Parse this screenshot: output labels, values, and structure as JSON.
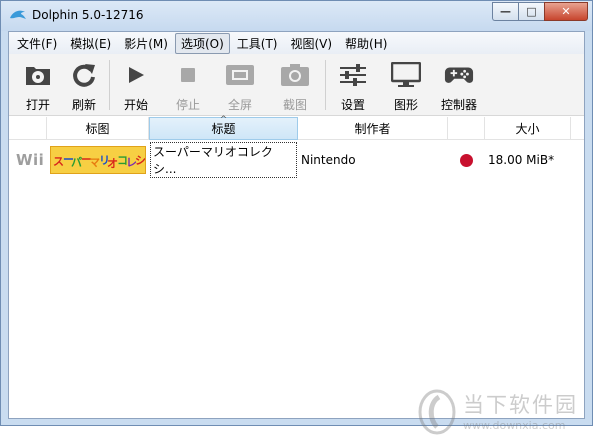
{
  "window": {
    "title": "Dolphin 5.0-12716",
    "controls": {
      "minimize": "—",
      "maximize": "□",
      "close": "✕"
    }
  },
  "menubar": {
    "items": [
      {
        "label": "文件(F)",
        "active": false
      },
      {
        "label": "模拟(E)",
        "active": false
      },
      {
        "label": "影片(M)",
        "active": false
      },
      {
        "label": "选项(O)",
        "active": true
      },
      {
        "label": "工具(T)",
        "active": false
      },
      {
        "label": "视图(V)",
        "active": false
      },
      {
        "label": "帮助(H)",
        "active": false
      }
    ]
  },
  "toolbar": {
    "open": "打开",
    "refresh": "刷新",
    "play": "开始",
    "stop": "停止",
    "fullscreen": "全屏",
    "screenshot": "截图",
    "config": "设置",
    "graphics": "图形",
    "controllers": "控制器"
  },
  "table": {
    "columns": {
      "banner": "标图",
      "title": "标题",
      "maker": "制作者",
      "size": "大小"
    },
    "sorted_column": "title",
    "rows": [
      {
        "platform": "Wii",
        "banner_text": "スーパーマリオコレクション",
        "title": "スーパーマリオコレクシ...",
        "maker": "Nintendo",
        "country_color": "#c8102e",
        "size": "18.00 MiB*"
      }
    ]
  },
  "watermark": {
    "main": "当下软件园",
    "url": "www.downxia.com"
  },
  "colors": {
    "titlebar": "#c6d9ef",
    "toolbar_bg": "#f3f3f3",
    "header_sorted": "#cfe6f7",
    "icon_dark": "#444444",
    "icon_disabled": "#a8a8a8"
  }
}
